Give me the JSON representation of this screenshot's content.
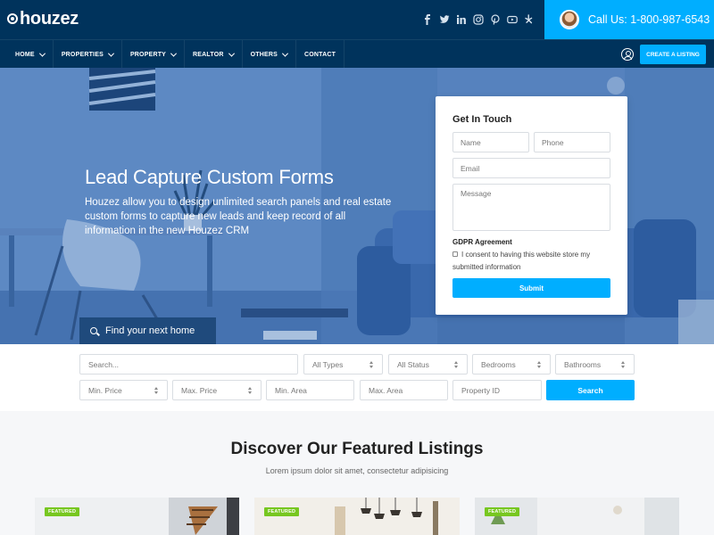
{
  "brand": {
    "name": "houzez"
  },
  "header": {
    "social_icons": [
      "facebook-icon",
      "twitter-icon",
      "linkedin-icon",
      "instagram-icon",
      "pinterest-icon",
      "youtube-icon",
      "yelp-icon"
    ],
    "call_label": "Call Us: 1-800-987-6543"
  },
  "nav": {
    "items": [
      {
        "label": "HOME",
        "has_dropdown": true
      },
      {
        "label": "PROPERTIES",
        "has_dropdown": true
      },
      {
        "label": "PROPERTY",
        "has_dropdown": true
      },
      {
        "label": "REALTOR",
        "has_dropdown": true
      },
      {
        "label": "OTHERS",
        "has_dropdown": true
      },
      {
        "label": "CONTACT",
        "has_dropdown": false
      }
    ],
    "create_listing_label": "CREATE A LISTING"
  },
  "hero": {
    "title": "Lead Capture Custom Forms",
    "subtitle": "Houzez allow you to design unlimited search panels and real estate custom forms to capture new leads and keep record of all information in the new Houzez CRM",
    "search_tab_label": "Find your next home"
  },
  "contact_form": {
    "title": "Get In Touch",
    "name_placeholder": "Name",
    "phone_placeholder": "Phone",
    "email_placeholder": "Email",
    "message_placeholder": "Message",
    "gdpr_title": "GDPR Agreement",
    "gdpr_text": "I consent to having this website store my submitted information",
    "submit_label": "Submit"
  },
  "search": {
    "keyword_placeholder": "Search...",
    "types_label": "All Types",
    "status_label": "All Status",
    "bedrooms_label": "Bedrooms",
    "bathrooms_label": "Bathrooms",
    "min_price_label": "Min. Price",
    "max_price_label": "Max. Price",
    "min_area_placeholder": "Min. Area",
    "max_area_placeholder": "Max. Area",
    "property_id_placeholder": "Property ID",
    "search_button_label": "Search"
  },
  "featured": {
    "title": "Discover Our Featured Listings",
    "subtitle": "Lorem ipsum dolor sit amet, consectetur adipisicing",
    "cards": [
      {
        "badge": "FEATURED"
      },
      {
        "badge": "FEATURED"
      },
      {
        "badge": "FEATURED"
      }
    ]
  },
  "colors": {
    "header_bg": "#00335c",
    "accent": "#00aeff",
    "featured_badge": "#77c720"
  }
}
